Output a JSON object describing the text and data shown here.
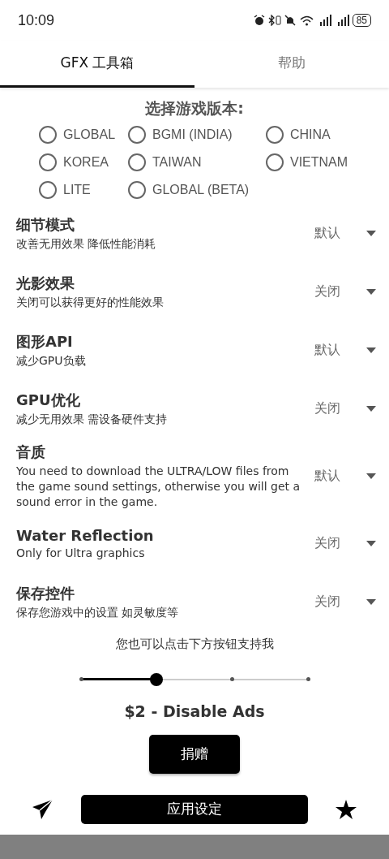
{
  "status_bar": {
    "time": "10:09",
    "battery": "85"
  },
  "tabs": [
    {
      "label": "GFX 工具箱",
      "selected": true
    },
    {
      "label": "帮助",
      "selected": false
    }
  ],
  "version_picker": {
    "title": "选择游戏版本:",
    "options": [
      {
        "label": "GLOBAL",
        "selected": false
      },
      {
        "label": "BGMI (INDIA)",
        "selected": false
      },
      {
        "label": "CHINA",
        "selected": false
      },
      {
        "label": "KOREA",
        "selected": false
      },
      {
        "label": "TAIWAN",
        "selected": false
      },
      {
        "label": "VIETNAM",
        "selected": false
      },
      {
        "label": "LITE",
        "selected": false
      },
      {
        "label": "GLOBAL (BETA)",
        "selected": false
      }
    ]
  },
  "settings": [
    {
      "title": "细节模式",
      "description": "改善无用效果 降低性能消耗",
      "value": "默认"
    },
    {
      "title": "光影效果",
      "description": "关闭可以获得更好的性能效果",
      "value": "关闭"
    },
    {
      "title": "图形API",
      "description": "减少GPU负载",
      "value": "默认"
    },
    {
      "title": "GPU优化",
      "description": "减少无用效果 需设备硬件支持",
      "value": "关闭"
    },
    {
      "title": "音质",
      "description": "You need to download the ULTRA/LOW files from the game sound settings, otherwise you will get a sound error in the game.",
      "value": "默认"
    },
    {
      "title": "Water Reflection",
      "description": "Only for Ultra graphics",
      "value": "关闭"
    },
    {
      "title": "保存控件",
      "description": "保存您游戏中的设置 如灵敏度等",
      "value": "关闭"
    }
  ],
  "donation": {
    "prompt": "您也可以点击下方按钮支持我",
    "slider": {
      "level": 0.333
    },
    "price": "$2 - Disable Ads",
    "button": "捐赠"
  },
  "apply_button": "应用设定"
}
